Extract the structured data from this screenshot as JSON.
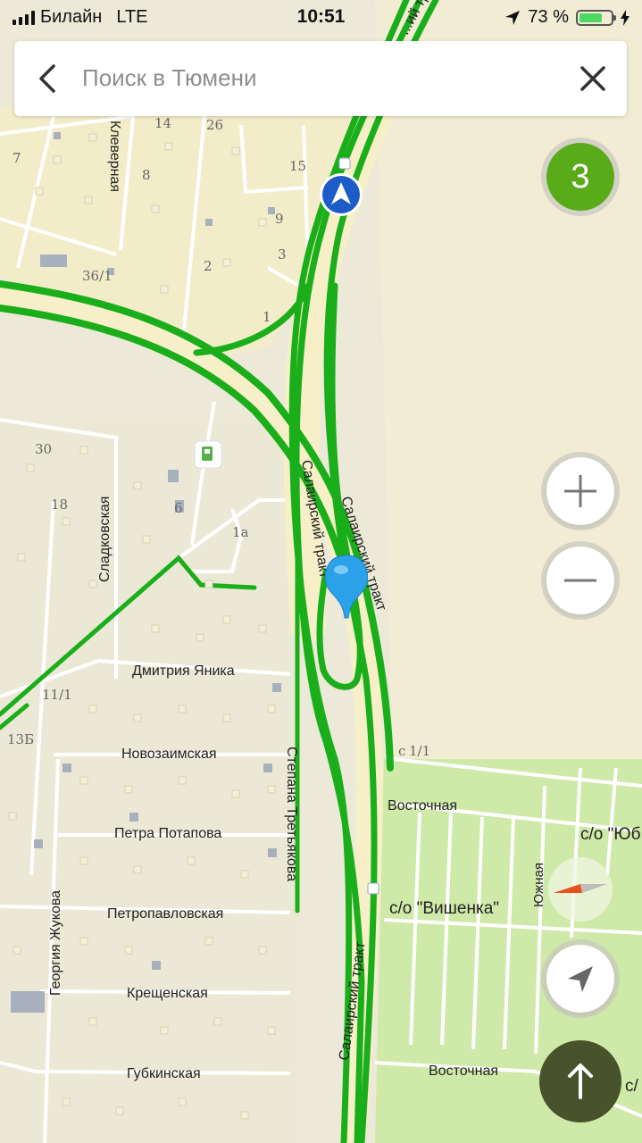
{
  "status_bar": {
    "carrier": "Билайн",
    "network": "LTE",
    "time": "10:51",
    "battery_percent": "73 %",
    "battery_level": 0.73
  },
  "search": {
    "placeholder": "Поиск в Тюмени",
    "back_icon": "chevron-left-icon",
    "close_icon": "close-icon"
  },
  "traffic": {
    "level": "3",
    "color": "#5aab1a"
  },
  "streets": {
    "salair_tract_1": "Салаирский тракт",
    "salair_tract_2": "Салаирский тракт",
    "salair_tract_3": "Салаирский тракт",
    "salair_tract_top": "...ий тракт",
    "klevernaya": "Клеверная",
    "sladkovskaya": "Сладковская",
    "dmitriya_yanika": "Дмитрия Яника",
    "novozaimskaya": "Новозаимская",
    "petra_potapova": "Петра Потапова",
    "petropavlovskaya": "Петропавловская",
    "kreshchenskaya": "Крещенская",
    "gubkinskaya": "Губкинская",
    "georgiya_zhukova": "Георгия Жукова",
    "stepana_tretyakova": "Степана Третьякова",
    "vostochnaya_1": "Восточная",
    "vostochnaya_2": "Восточная",
    "yuzhnaya": "Южная",
    "so_vishenka": "с/о \"Вишенка\"",
    "so_yu": "с/о \"Юб",
    "so_cut": "с/"
  },
  "house_numbers": {
    "n14": "14",
    "n26": "26",
    "n7": "7",
    "n8": "8",
    "n15": "15",
    "n9": "9",
    "n3": "3",
    "n2": "2",
    "n36_1": "36/1",
    "n1": "1",
    "n30": "30",
    "n18": "18",
    "n6": "6",
    "n1a": "1а",
    "n11_1": "11/1",
    "n13b": "13Б",
    "n1_1": "1/1",
    "nc": "с"
  },
  "controls": {
    "zoom_in": "+",
    "zoom_out": "−",
    "my_location_icon": "location-arrow-icon",
    "compass_icon": "compass-icon",
    "nav_icon": "arrow-up-icon"
  },
  "colors": {
    "map_background": "#ece9d8",
    "traffic_green": "#1aae1a",
    "park_green": "#cde9a6",
    "road_fill": "#f6efc8",
    "pin_blue": "#2aa1e8",
    "location_blue": "#1d5cc8"
  }
}
